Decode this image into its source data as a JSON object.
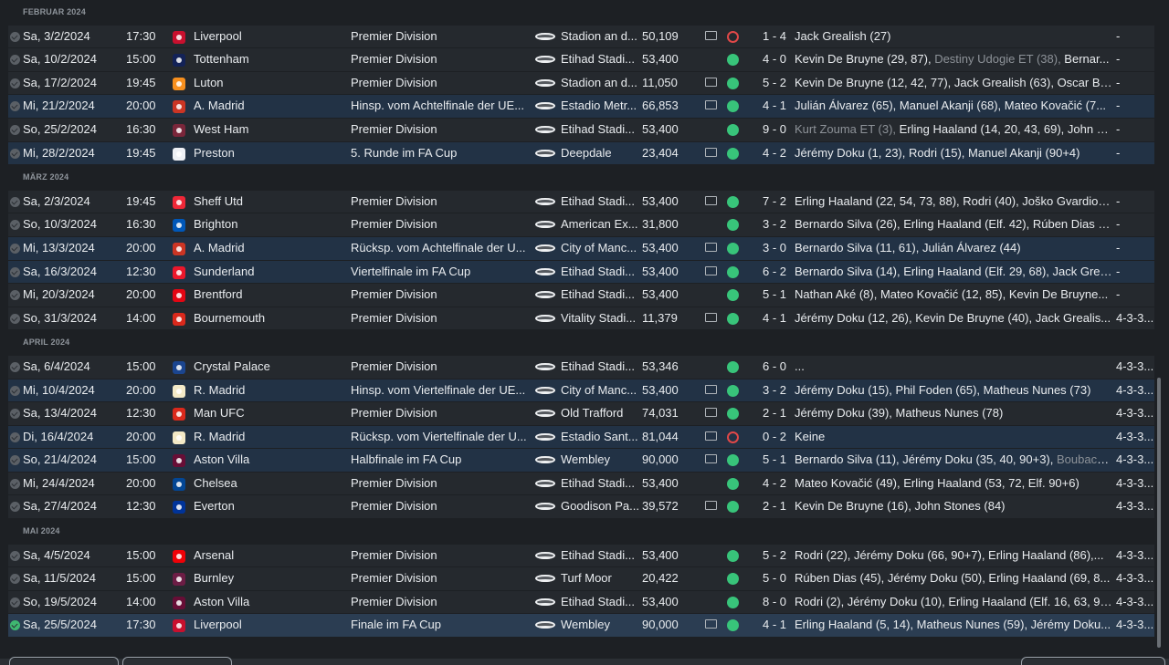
{
  "months": [
    {
      "label": "FEBRUAR 2024",
      "matches": [
        {
          "date": "Sa, 3/2/2024",
          "time": "17:30",
          "opponent": "Liverpool",
          "badge_color": "#c8102e",
          "competition": "Premier Division",
          "stadium": "Stadion an d...",
          "attendance": "50,109",
          "tv": true,
          "result": "loss",
          "score": "1 - 4",
          "scorers": "Jack Grealish (27)",
          "scorers_grey": "",
          "form": "-",
          "style": "league",
          "done": false
        },
        {
          "date": "Sa, 10/2/2024",
          "time": "15:00",
          "opponent": "Tottenham",
          "badge_color": "#132257",
          "competition": "Premier Division",
          "stadium": "Etihad Stadi...",
          "attendance": "53,400",
          "tv": false,
          "result": "win",
          "score": "4 - 0",
          "scorers": "Kevin De Bruyne (29, 87),",
          "scorers_grey": " Destiny Udogie ET (38),",
          "scorers_tail": " Bernar...",
          "form": "-",
          "style": "league",
          "done": false
        },
        {
          "date": "Sa, 17/2/2024",
          "time": "19:45",
          "opponent": "Luton",
          "badge_color": "#f78f1e",
          "competition": "Premier Division",
          "stadium": "Stadion an d...",
          "attendance": "11,050",
          "tv": true,
          "result": "win",
          "score": "5 - 2",
          "scorers": "Kevin De Bruyne (12, 42, 77), Jack Grealish (63), Oscar Bo...",
          "scorers_grey": "",
          "form": "-",
          "style": "league",
          "done": false
        },
        {
          "date": "Mi, 21/2/2024",
          "time": "20:00",
          "opponent": "A. Madrid",
          "badge_color": "#cb3524",
          "competition": "Hinsp. vom Achtelfinale der UE...",
          "stadium": "Estadio Metr...",
          "attendance": "66,853",
          "tv": true,
          "result": "win",
          "score": "4 - 1",
          "scorers": "Julián Álvarez (65), Manuel Akanji (68), Mateo Kovačić (7...",
          "scorers_grey": "",
          "form": "-",
          "style": "cup",
          "done": false
        },
        {
          "date": "So, 25/2/2024",
          "time": "16:30",
          "opponent": "West Ham",
          "badge_color": "#7a263a",
          "competition": "Premier Division",
          "stadium": "Etihad Stadi...",
          "attendance": "53,400",
          "tv": false,
          "result": "win",
          "score": "9 - 0",
          "scorers": "",
          "scorers_grey": "Kurt Zouma ET (3),",
          "scorers_tail": " Erling Haaland (14, 20, 43, 69), John St...",
          "form": "-",
          "style": "league",
          "done": false
        },
        {
          "date": "Mi, 28/2/2024",
          "time": "19:45",
          "opponent": "Preston",
          "badge_color": "#eef0f5",
          "competition": "5. Runde im FA Cup",
          "stadium": "Deepdale",
          "attendance": "23,404",
          "tv": true,
          "result": "win",
          "score": "4 - 2",
          "scorers": "Jérémy Doku (1, 23), Rodri (15), Manuel Akanji (90+4)",
          "scorers_grey": "",
          "form": "-",
          "style": "cup",
          "done": false
        }
      ]
    },
    {
      "label": "MÄRZ 2024",
      "matches": [
        {
          "date": "Sa, 2/3/2024",
          "time": "19:45",
          "opponent": "Sheff Utd",
          "badge_color": "#ee2737",
          "competition": "Premier Division",
          "stadium": "Etihad Stadi...",
          "attendance": "53,400",
          "tv": true,
          "result": "win",
          "score": "7 - 2",
          "scorers": "Erling Haaland (22, 54, 73, 88), Rodri (40), Joško Gvardiol (...",
          "scorers_grey": "",
          "form": "-",
          "style": "league",
          "done": false
        },
        {
          "date": "So, 10/3/2024",
          "time": "16:30",
          "opponent": "Brighton",
          "badge_color": "#0057b8",
          "competition": "Premier Division",
          "stadium": "American Ex...",
          "attendance": "31,800",
          "tv": false,
          "result": "win",
          "score": "3 - 2",
          "scorers": "Bernardo Silva (26), Erling Haaland (Elf. 42), Rúben Dias (5...",
          "scorers_grey": "",
          "form": "-",
          "style": "league",
          "done": false
        },
        {
          "date": "Mi, 13/3/2024",
          "time": "20:00",
          "opponent": "A. Madrid",
          "badge_color": "#cb3524",
          "competition": "Rücksp. vom Achtelfinale der U...",
          "stadium": "City of Manc...",
          "attendance": "53,400",
          "tv": true,
          "result": "win",
          "score": "3 - 0",
          "scorers": "Bernardo Silva (11, 61), Julián Álvarez (44)",
          "scorers_grey": "",
          "form": "-",
          "style": "cup",
          "done": false
        },
        {
          "date": "Sa, 16/3/2024",
          "time": "12:30",
          "opponent": "Sunderland",
          "badge_color": "#eb172b",
          "competition": "Viertelfinale im FA Cup",
          "stadium": "Etihad Stadi...",
          "attendance": "53,400",
          "tv": true,
          "result": "win",
          "score": "6 - 2",
          "scorers": "Bernardo Silva (14), Erling Haaland (Elf. 29, 68), Jack Greal...",
          "scorers_grey": "",
          "form": "-",
          "style": "cup",
          "done": false
        },
        {
          "date": "Mi, 20/3/2024",
          "time": "20:00",
          "opponent": "Brentford",
          "badge_color": "#e30613",
          "competition": "Premier Division",
          "stadium": "Etihad Stadi...",
          "attendance": "53,400",
          "tv": false,
          "result": "win",
          "score": "5 - 1",
          "scorers": "Nathan Aké (8), Mateo Kovačić (12, 85), Kevin De Bruyne...",
          "scorers_grey": "",
          "form": "-",
          "style": "league",
          "done": false
        },
        {
          "date": "So, 31/3/2024",
          "time": "14:00",
          "opponent": "Bournemouth",
          "badge_color": "#da291c",
          "competition": "Premier Division",
          "stadium": "Vitality Stadi...",
          "attendance": "11,379",
          "tv": true,
          "result": "win",
          "score": "4 - 1",
          "scorers": "Jérémy Doku (12, 26), Kevin De Bruyne (40), Jack Grealis...",
          "scorers_grey": "",
          "form": "4-3-3...",
          "style": "league",
          "done": false
        }
      ]
    },
    {
      "label": "APRIL 2024",
      "matches": [
        {
          "date": "Sa, 6/4/2024",
          "time": "15:00",
          "opponent": "Crystal Palace",
          "badge_color": "#1b458f",
          "competition": "Premier Division",
          "stadium": "Etihad Stadi...",
          "attendance": "53,346",
          "tv": false,
          "result": "win",
          "score": "6 - 0",
          "scorers": "...",
          "scorers_grey": "",
          "form": "4-3-3...",
          "style": "league",
          "done": false
        },
        {
          "date": "Mi, 10/4/2024",
          "time": "20:00",
          "opponent": "R. Madrid",
          "badge_color": "#f3e9c6",
          "competition": "Hinsp. vom Viertelfinale der UE...",
          "stadium": "City of Manc...",
          "attendance": "53,400",
          "tv": true,
          "result": "win",
          "score": "3 - 2",
          "scorers": "Jérémy Doku (15), Phil Foden (65), Matheus Nunes (73)",
          "scorers_grey": "",
          "form": "4-3-3...",
          "style": "cup",
          "done": false
        },
        {
          "date": "Sa, 13/4/2024",
          "time": "12:30",
          "opponent": "Man UFC",
          "badge_color": "#da291c",
          "competition": "Premier Division",
          "stadium": "Old Trafford",
          "attendance": "74,031",
          "tv": true,
          "result": "win",
          "score": "2 - 1",
          "scorers": "Jérémy Doku (39), Matheus Nunes (78)",
          "scorers_grey": "",
          "form": "4-3-3...",
          "style": "league",
          "done": false
        },
        {
          "date": "Di, 16/4/2024",
          "time": "20:00",
          "opponent": "R. Madrid",
          "badge_color": "#f3e9c6",
          "competition": "Rücksp. vom Viertelfinale der U...",
          "stadium": "Estadio Sant...",
          "attendance": "81,044",
          "tv": true,
          "result": "loss",
          "score": "0 - 2",
          "scorers": "Keine",
          "scorers_grey": "",
          "form": "4-3-3...",
          "style": "cup",
          "done": false
        },
        {
          "date": "So, 21/4/2024",
          "time": "15:00",
          "opponent": "Aston Villa",
          "badge_color": "#670e36",
          "competition": "Halbfinale im FA Cup",
          "stadium": "Wembley",
          "attendance": "90,000",
          "tv": true,
          "result": "win",
          "score": "5 - 1",
          "scorers": "Bernardo Silva (11), Jérémy Doku (35, 40, 90+3),",
          "scorers_grey": " Boubaca...",
          "form": "4-3-3...",
          "style": "cup",
          "done": false
        },
        {
          "date": "Mi, 24/4/2024",
          "time": "20:00",
          "opponent": "Chelsea",
          "badge_color": "#034694",
          "competition": "Premier Division",
          "stadium": "Etihad Stadi...",
          "attendance": "53,400",
          "tv": false,
          "result": "win",
          "score": "4 - 2",
          "scorers": "Mateo Kovačić (49), Erling Haaland (53, 72, Elf. 90+6)",
          "scorers_grey": "",
          "form": "4-3-3...",
          "style": "league",
          "done": false
        },
        {
          "date": "Sa, 27/4/2024",
          "time": "12:30",
          "opponent": "Everton",
          "badge_color": "#003399",
          "competition": "Premier Division",
          "stadium": "Goodison Pa...",
          "attendance": "39,572",
          "tv": true,
          "result": "win",
          "score": "2 - 1",
          "scorers": "Kevin De Bruyne (16), John Stones (84)",
          "scorers_grey": "",
          "form": "4-3-3...",
          "style": "league",
          "done": false
        }
      ]
    },
    {
      "label": "MAI 2024",
      "matches": [
        {
          "date": "Sa, 4/5/2024",
          "time": "15:00",
          "opponent": "Arsenal",
          "badge_color": "#ef0107",
          "competition": "Premier Division",
          "stadium": "Etihad Stadi...",
          "attendance": "53,400",
          "tv": false,
          "result": "win",
          "score": "5 - 2",
          "scorers": "Rodri (22), Jérémy Doku (66, 90+7), Erling Haaland (86),...",
          "scorers_grey": "",
          "form": "4-3-3...",
          "style": "league",
          "done": false
        },
        {
          "date": "Sa, 11/5/2024",
          "time": "15:00",
          "opponent": "Burnley",
          "badge_color": "#6c1d45",
          "competition": "Premier Division",
          "stadium": "Turf Moor",
          "attendance": "20,422",
          "tv": false,
          "result": "win",
          "score": "5 - 0",
          "scorers": "Rúben Dias (45), Jérémy Doku (50), Erling Haaland (69, 8...",
          "scorers_grey": "",
          "form": "4-3-3...",
          "style": "league",
          "done": false
        },
        {
          "date": "So, 19/5/2024",
          "time": "14:00",
          "opponent": "Aston Villa",
          "badge_color": "#670e36",
          "competition": "Premier Division",
          "stadium": "Etihad Stadi...",
          "attendance": "53,400",
          "tv": false,
          "result": "win",
          "score": "8 - 0",
          "scorers": "Rodri (2), Jérémy Doku (10), Erling Haaland (Elf. 16, 63, 90...",
          "scorers_grey": "",
          "form": "4-3-3...",
          "style": "league",
          "done": false
        },
        {
          "date": "Sa, 25/5/2024",
          "time": "17:30",
          "opponent": "Liverpool",
          "badge_color": "#c8102e",
          "competition": "Finale im FA Cup",
          "stadium": "Wembley",
          "attendance": "90,000",
          "tv": true,
          "result": "win",
          "score": "4 - 1",
          "scorers": "Erling Haaland (5, 14), Matheus Nunes (59), Jérémy Doku...",
          "scorers_grey": "",
          "form": "4-3-3...",
          "style": "final",
          "done": true
        }
      ]
    }
  ]
}
